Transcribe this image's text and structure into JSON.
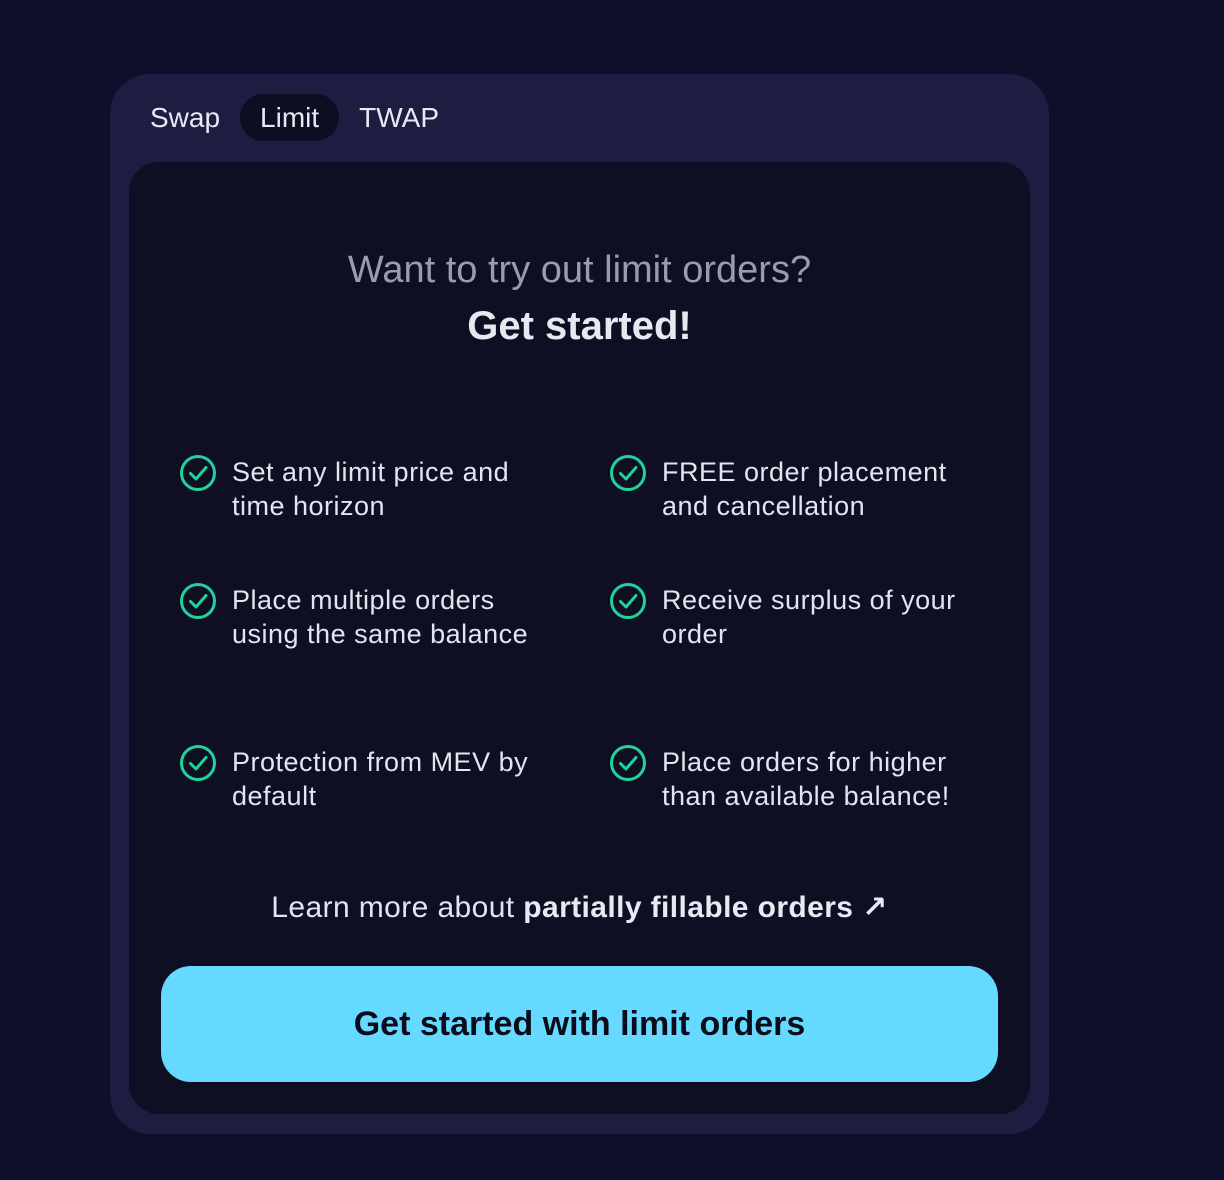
{
  "tabs": [
    {
      "label": "Swap"
    },
    {
      "label": "Limit"
    },
    {
      "label": "TWAP"
    }
  ],
  "active_tab": "Limit",
  "heading": {
    "subtitle": "Want to try out limit orders?",
    "title": "Get started!"
  },
  "features": [
    {
      "text": "Set any limit price and time horizon"
    },
    {
      "text": "FREE order placement and cancellation"
    },
    {
      "text": "Place multiple orders using the same balance"
    },
    {
      "text": "Receive surplus of your order"
    },
    {
      "text": "Protection from MEV by default"
    },
    {
      "text": "Place orders for higher than available balance!"
    }
  ],
  "learn_more": {
    "prefix": "Learn more about",
    "link_text": "partially fillable orders",
    "arrow": "↗"
  },
  "cta": {
    "label": "Get started with limit orders"
  },
  "colors": {
    "background": "#0e0f2b",
    "widget": "#1c1d40",
    "panel": "#0e0f22",
    "check_icon": "#1fd39a",
    "cta_button": "#65d9ff"
  },
  "icons": {
    "feature_check": "check-circle-icon"
  }
}
